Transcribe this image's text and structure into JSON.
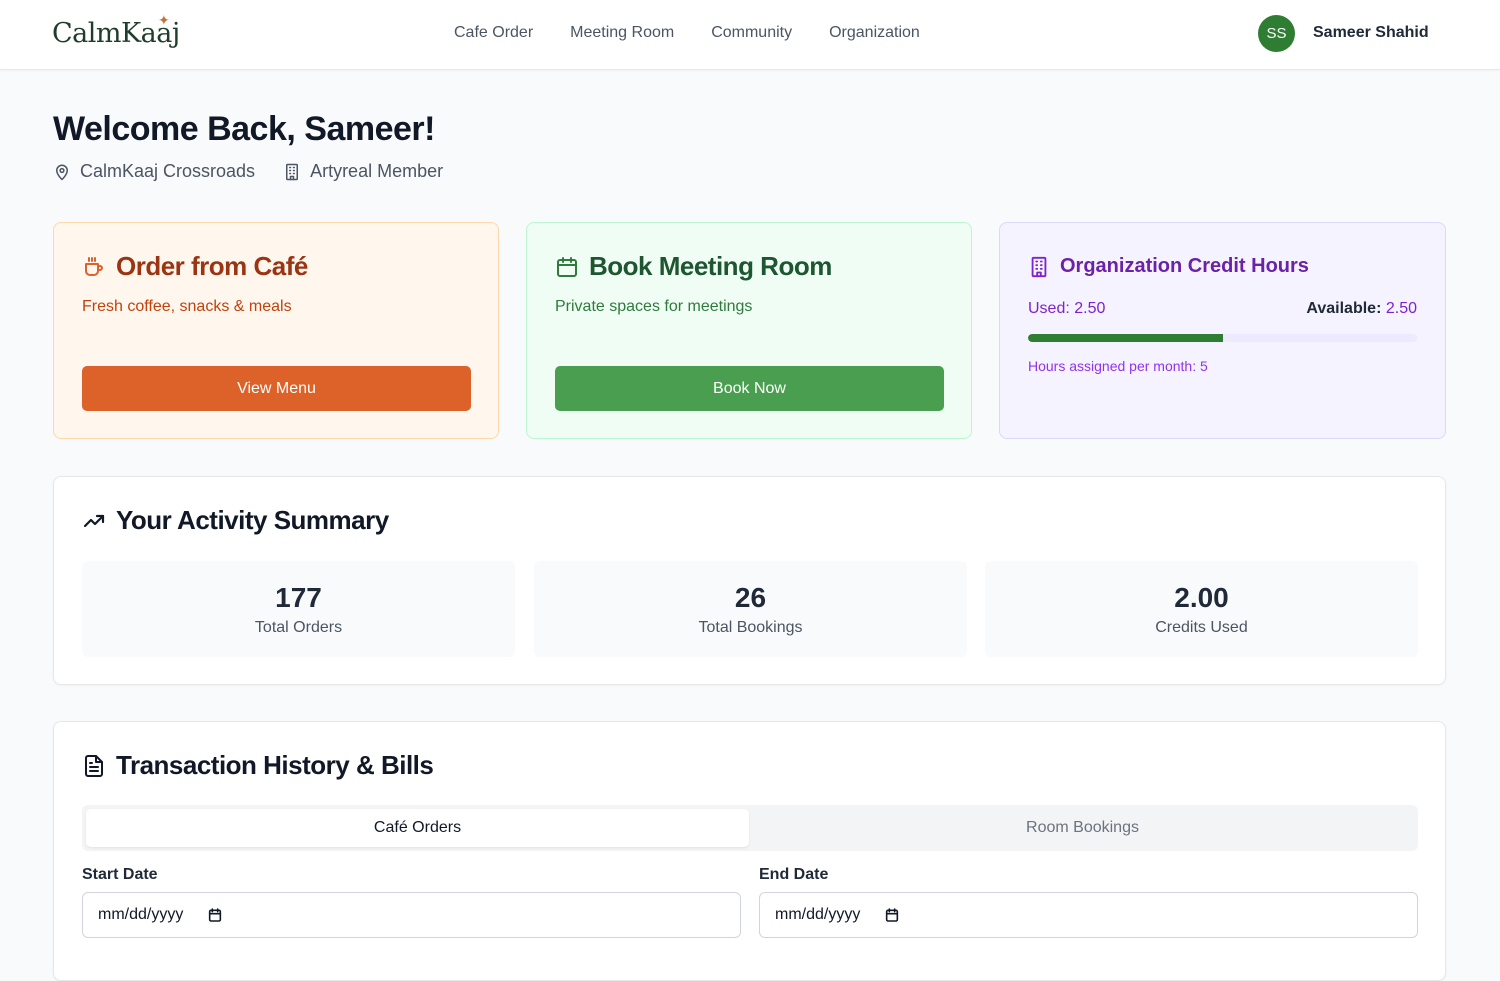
{
  "header": {
    "logo": "CalmKaaj",
    "nav": [
      "Cafe Order",
      "Meeting Room",
      "Community",
      "Organization"
    ],
    "user_initials": "SS",
    "user_name": "Sameer Shahid"
  },
  "welcome": {
    "title": "Welcome Back, Sameer!",
    "location": "CalmKaaj Crossroads",
    "membership": "Artyreal Member"
  },
  "cafe_card": {
    "title": "Order from Café",
    "subtitle": "Fresh coffee, snacks & meals",
    "button": "View Menu"
  },
  "room_card": {
    "title": "Book Meeting Room",
    "subtitle": "Private spaces for meetings",
    "button": "Book Now"
  },
  "credit_card": {
    "title": "Organization Credit Hours",
    "used_label": "Used: 2.50",
    "available_label": "Available:",
    "available_value": "2.50",
    "used_fraction": 0.5,
    "note": "Hours assigned per month: 5"
  },
  "activity": {
    "title": "Your Activity Summary",
    "stats": [
      {
        "value": "177",
        "label": "Total Orders"
      },
      {
        "value": "26",
        "label": "Total Bookings"
      },
      {
        "value": "2.00",
        "label": "Credits Used"
      }
    ]
  },
  "transactions": {
    "title": "Transaction History & Bills",
    "tabs": [
      "Café Orders",
      "Room Bookings"
    ],
    "start_label": "Start Date",
    "end_label": "End Date",
    "start_value": "mm/dd/yyyy",
    "end_value": "mm/dd/yyyy"
  },
  "colors": {
    "accent_green": "#2e7d32",
    "cafe_orange": "#dd6229",
    "room_green": "#4a9e4f",
    "credit_purple": "#7e22ce"
  }
}
